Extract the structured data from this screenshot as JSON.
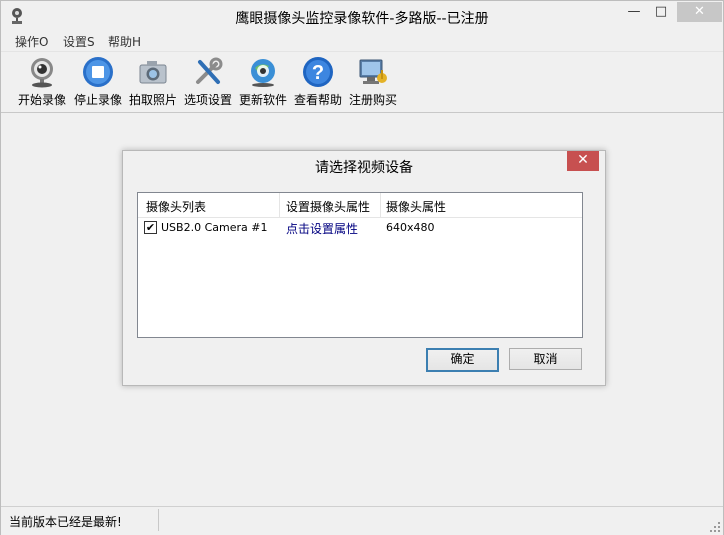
{
  "window": {
    "title": "鹰眼摄像头监控录像软件-多路版--已注册",
    "min_glyph": "—",
    "max_glyph": "□",
    "close_glyph": "✕"
  },
  "menu": {
    "items": [
      {
        "label": "操作O"
      },
      {
        "label": "设置S"
      },
      {
        "label": "帮助H"
      }
    ]
  },
  "toolbar": {
    "items": [
      {
        "label": "开始录像",
        "icon": "webcam-icon"
      },
      {
        "label": "停止录像",
        "icon": "stop-icon"
      },
      {
        "label": "拍取照片",
        "icon": "camera-icon"
      },
      {
        "label": "选项设置",
        "icon": "tools-icon"
      },
      {
        "label": "更新软件",
        "icon": "update-icon"
      },
      {
        "label": "查看帮助",
        "icon": "help-icon"
      },
      {
        "label": "注册购买",
        "icon": "register-icon"
      }
    ]
  },
  "dialog": {
    "title": "请选择视频设备",
    "close_glyph": "✕",
    "columns": [
      "摄像头列表",
      "设置摄像头属性",
      "摄像头属性"
    ],
    "rows": [
      {
        "checked": "✔",
        "name": "USB2.0 Camera #1",
        "action": "点击设置属性",
        "props": "640x480"
      }
    ],
    "ok_label": "确定",
    "cancel_label": "取消"
  },
  "status": {
    "text": "当前版本已经是最新!"
  },
  "colors": {
    "accent": "#3c7fb1",
    "close_red": "#c75050",
    "link": "#000080"
  }
}
